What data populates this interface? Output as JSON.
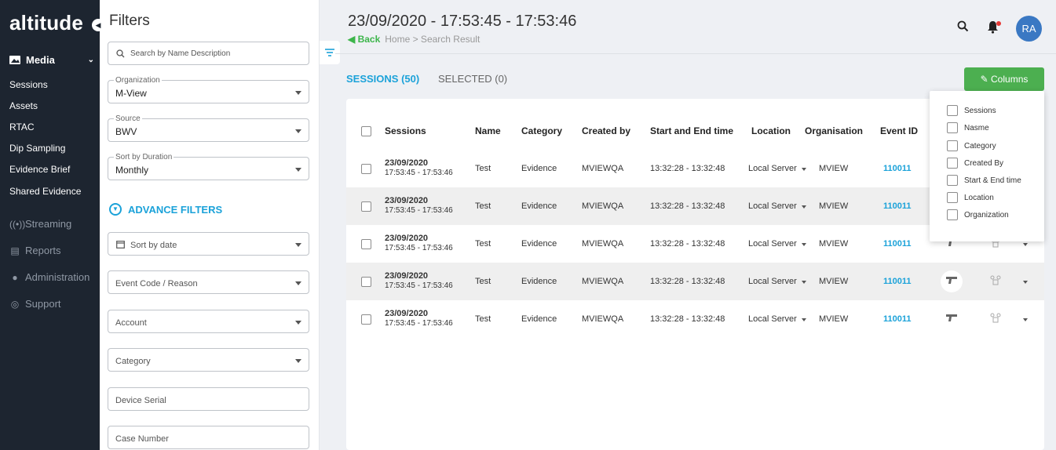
{
  "app": {
    "logo": "altitude"
  },
  "sidebar": {
    "media_label": "Media",
    "sub_items": [
      "Sessions",
      "Assets",
      "RTAC",
      "Dip Sampling",
      "Evidence Brief",
      "Shared Evidence"
    ],
    "main_items": [
      {
        "label": "Streaming",
        "icon": "streaming-icon"
      },
      {
        "label": "Reports",
        "icon": "reports-icon"
      },
      {
        "label": "Administration",
        "icon": "administration-icon"
      },
      {
        "label": "Support",
        "icon": "support-icon"
      }
    ]
  },
  "filters": {
    "title": "Filters",
    "search_placeholder": "Search by Name Description",
    "organization": {
      "label": "Organization",
      "value": "M-View"
    },
    "source": {
      "label": "Source",
      "value": "BWV"
    },
    "sort_duration": {
      "label": "Sort by Duration",
      "value": "Monthly"
    },
    "advance_label": "ADVANCE FILTERS",
    "sort_by_date": "Sort by date",
    "event_code": "Event Code / Reason",
    "account": "Account",
    "category": "Category",
    "device_serial": "Device Serial",
    "case_number": "Case Number"
  },
  "header": {
    "title": "23/09/2020 - 17:53:45 - 17:53:46",
    "back_label": "Back",
    "breadcrumb": "Home > Search Result",
    "avatar_initials": "RA"
  },
  "tabs": {
    "sessions": "SESSIONS (50)",
    "selected": "SELECTED (0)"
  },
  "columns_button": "Columns",
  "table": {
    "headers": {
      "sessions": "Sessions",
      "name": "Name",
      "category": "Category",
      "created_by": "Created by",
      "start_end": "Start and End time",
      "location": "Location",
      "organisation": "Organisation",
      "event_id": "Event ID"
    },
    "rows": [
      {
        "date": "23/09/2020",
        "time": "17:53:45 - 17:53:46",
        "name": "Test",
        "category": "Evidence",
        "created_by": "MVIEWQA",
        "start_end": "13:32:28 - 13:32:48",
        "location": "Local Server",
        "organisation": "MVIEW",
        "event_id": "110011"
      },
      {
        "date": "23/09/2020",
        "time": "17:53:45 - 17:53:46",
        "name": "Test",
        "category": "Evidence",
        "created_by": "MVIEWQA",
        "start_end": "13:32:28 - 13:32:48",
        "location": "Local Server",
        "organisation": "MVIEW",
        "event_id": "110011"
      },
      {
        "date": "23/09/2020",
        "time": "17:53:45 - 17:53:46",
        "name": "Test",
        "category": "Evidence",
        "created_by": "MVIEWQA",
        "start_end": "13:32:28 - 13:32:48",
        "location": "Local Server",
        "organisation": "MVIEW",
        "event_id": "110011"
      },
      {
        "date": "23/09/2020",
        "time": "17:53:45 - 17:53:46",
        "name": "Test",
        "category": "Evidence",
        "created_by": "MVIEWQA",
        "start_end": "13:32:28 - 13:32:48",
        "location": "Local Server",
        "organisation": "MVIEW",
        "event_id": "110011"
      },
      {
        "date": "23/09/2020",
        "time": "17:53:45 - 17:53:46",
        "name": "Test",
        "category": "Evidence",
        "created_by": "MVIEWQA",
        "start_end": "13:32:28 - 13:32:48",
        "location": "Local Server",
        "organisation": "MVIEW",
        "event_id": "110011"
      }
    ]
  },
  "columns_menu": [
    "Sessions",
    "Nasme",
    "Category",
    "Created By",
    "Start & End time",
    "Location",
    "Organization"
  ],
  "colors": {
    "accent": "#1ba2d9",
    "green": "#4caf50",
    "sidebar": "#1d2530",
    "avatar": "#3a78c3"
  }
}
